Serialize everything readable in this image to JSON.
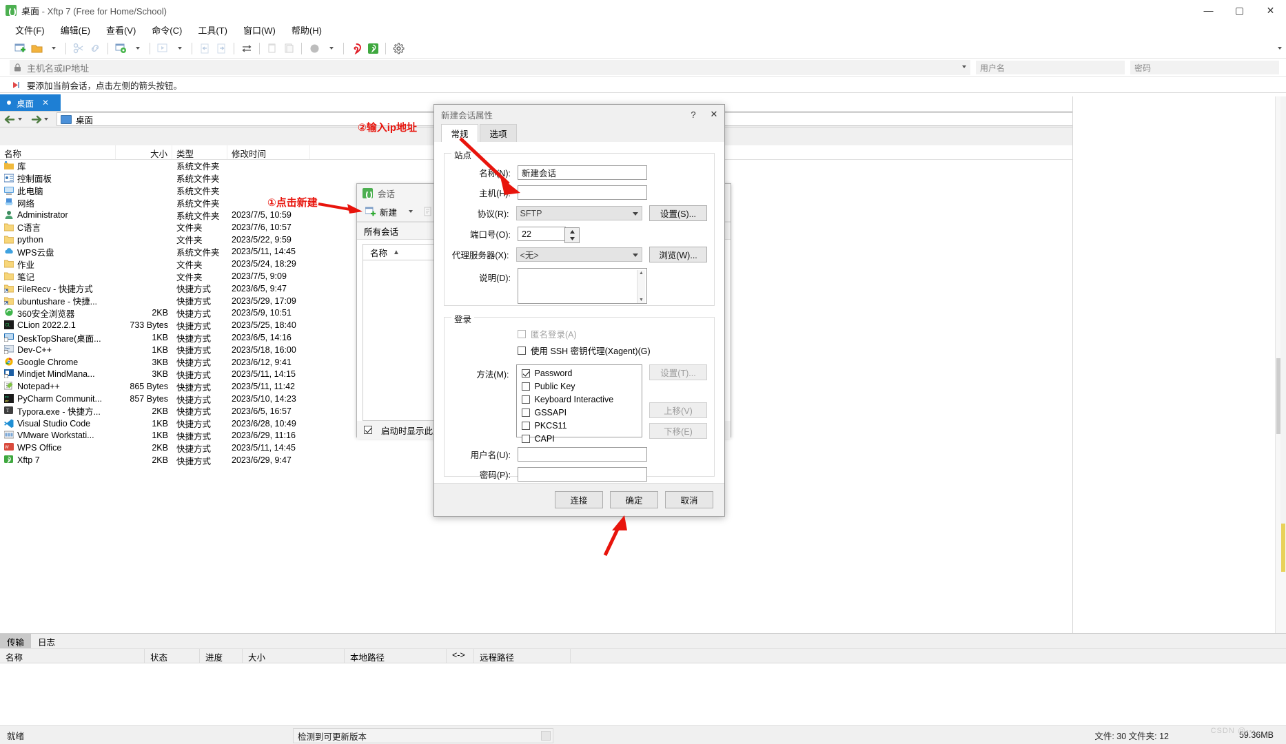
{
  "window": {
    "title_main": "桌面",
    "title_rest": " - Xftp 7 (Free for Home/School)",
    "minimize": "—",
    "maximize": "▢",
    "close": "✕"
  },
  "menubar": {
    "items": [
      "文件(F)",
      "编辑(E)",
      "查看(V)",
      "命令(C)",
      "工具(T)",
      "窗口(W)",
      "帮助(H)"
    ]
  },
  "addressbar": {
    "host_placeholder": "主机名或IP地址",
    "username_placeholder": "用户名",
    "password_placeholder": "密码"
  },
  "hintbar": {
    "text": "要添加当前会话，点击左侧的箭头按钮。"
  },
  "tabs": {
    "active_label": "桌面",
    "close": "✕",
    "nav_left": "◄",
    "nav_right": "►"
  },
  "pathbar": {
    "back": "←",
    "forward": "→",
    "path": "桌面",
    "star": "★",
    "refresh": "⟳"
  },
  "filelist": {
    "columns": [
      "名称",
      "大小",
      "类型",
      "修改时间"
    ],
    "rows": [
      {
        "name": "库",
        "size": "",
        "type": "系统文件夹",
        "time": "",
        "icon": "library-folder-icon"
      },
      {
        "name": "控制面板",
        "size": "",
        "type": "系统文件夹",
        "time": "",
        "icon": "control-panel-icon"
      },
      {
        "name": "此电脑",
        "size": "",
        "type": "系统文件夹",
        "time": "",
        "icon": "this-pc-icon"
      },
      {
        "name": "网络",
        "size": "",
        "type": "系统文件夹",
        "time": "",
        "icon": "network-icon"
      },
      {
        "name": "Administrator",
        "size": "",
        "type": "系统文件夹",
        "time": "2023/7/5, 10:59",
        "icon": "user-icon"
      },
      {
        "name": "C语言",
        "size": "",
        "type": "文件夹",
        "time": "2023/7/6, 10:57",
        "icon": "folder-icon"
      },
      {
        "name": "python",
        "size": "",
        "type": "文件夹",
        "time": "2023/5/22, 9:59",
        "icon": "folder-icon"
      },
      {
        "name": "WPS云盘",
        "size": "",
        "type": "系统文件夹",
        "time": "2023/5/11, 14:45",
        "icon": "cloud-icon"
      },
      {
        "name": "作业",
        "size": "",
        "type": "文件夹",
        "time": "2023/5/24, 18:29",
        "icon": "folder-icon"
      },
      {
        "name": "笔记",
        "size": "",
        "type": "文件夹",
        "time": "2023/7/5, 9:09",
        "icon": "folder-icon"
      },
      {
        "name": "FileRecv - 快捷方式",
        "size": "",
        "type": "快捷方式",
        "time": "2023/6/5, 9:47",
        "icon": "folder-shortcut-icon"
      },
      {
        "name": "ubuntushare - 快捷...",
        "size": "",
        "type": "快捷方式",
        "time": "2023/5/29, 17:09",
        "icon": "folder-shortcut-icon"
      },
      {
        "name": "360安全浏览器",
        "size": "2KB",
        "type": "快捷方式",
        "time": "2023/5/9, 10:51",
        "icon": "browser-360-icon"
      },
      {
        "name": "CLion 2022.2.1",
        "size": "733 Bytes",
        "type": "快捷方式",
        "time": "2023/5/25, 18:40",
        "icon": "clion-icon"
      },
      {
        "name": "DeskTopShare(桌面...",
        "size": "1KB",
        "type": "快捷方式",
        "time": "2023/6/5, 14:16",
        "icon": "desktopshare-icon"
      },
      {
        "name": "Dev-C++",
        "size": "1KB",
        "type": "快捷方式",
        "time": "2023/5/18, 16:00",
        "icon": "devcpp-icon"
      },
      {
        "name": "Google Chrome",
        "size": "3KB",
        "type": "快捷方式",
        "time": "2023/6/12, 9:41",
        "icon": "chrome-icon"
      },
      {
        "name": "Mindjet MindMana...",
        "size": "3KB",
        "type": "快捷方式",
        "time": "2023/5/11, 14:15",
        "icon": "mindjet-icon"
      },
      {
        "name": "Notepad++",
        "size": "865 Bytes",
        "type": "快捷方式",
        "time": "2023/5/11, 11:42",
        "icon": "notepadpp-icon"
      },
      {
        "name": "PyCharm Communit...",
        "size": "857 Bytes",
        "type": "快捷方式",
        "time": "2023/5/10, 14:23",
        "icon": "pycharm-icon"
      },
      {
        "name": "Typora.exe - 快捷方...",
        "size": "2KB",
        "type": "快捷方式",
        "time": "2023/6/5, 16:57",
        "icon": "typora-icon"
      },
      {
        "name": "Visual Studio Code",
        "size": "1KB",
        "type": "快捷方式",
        "time": "2023/6/28, 10:49",
        "icon": "vscode-icon"
      },
      {
        "name": "VMware Workstati...",
        "size": "1KB",
        "type": "快捷方式",
        "time": "2023/6/29, 11:16",
        "icon": "vmware-icon"
      },
      {
        "name": "WPS Office",
        "size": "2KB",
        "type": "快捷方式",
        "time": "2023/5/11, 14:45",
        "icon": "wps-icon"
      },
      {
        "name": "Xftp 7",
        "size": "2KB",
        "type": "快捷方式",
        "time": "2023/6/29, 9:47",
        "icon": "xftp-icon"
      }
    ]
  },
  "transfer_panel": {
    "tabs": [
      "传输",
      "日志"
    ],
    "active_tab": "传输",
    "columns": [
      "名称",
      "状态",
      "进度",
      "大小",
      "本地路径",
      "<->",
      "远程路径"
    ]
  },
  "statusbar": {
    "ready": "就绪",
    "update_text": "检测到可更新版本",
    "files": "文件: 30  文件夹: 12",
    "size": "59.36MB",
    "watermark": "CSDN @🞄🞄🞄"
  },
  "sessions_window": {
    "title": "会话",
    "close": "✕",
    "new_button": "新建",
    "all_sessions": "所有会话",
    "list_column": "名称",
    "sort_arrow": "▲",
    "startup_checkbox": "启动时显示此对话框(",
    "startup_checked": true
  },
  "dialog": {
    "title": "新建会话属性",
    "help": "?",
    "close": "✕",
    "tabs": [
      "常规",
      "选项"
    ],
    "active_tab": "常规",
    "site_group": "站点",
    "fields": {
      "name_label": "名称(N):",
      "name_value": "新建会话",
      "host_label": "主机(H):",
      "host_value": "",
      "protocol_label": "协议(R):",
      "protocol_value": "SFTP",
      "protocol_button": "设置(S)...",
      "port_label": "端口号(O):",
      "port_value": "22",
      "proxy_label": "代理服务器(X):",
      "proxy_value": "<无>",
      "proxy_button": "浏览(W)...",
      "desc_label": "说明(D):",
      "desc_value": ""
    },
    "login_group": "登录",
    "anonymous_label": "匿名登录(A)",
    "anonymous_checked": false,
    "xagent_label": "使用 SSH 密钥代理(Xagent)(G)",
    "xagent_checked": false,
    "method_label": "方法(M):",
    "methods": [
      {
        "label": "Password",
        "checked": true
      },
      {
        "label": "Public Key",
        "checked": false
      },
      {
        "label": "Keyboard Interactive",
        "checked": false
      },
      {
        "label": "GSSAPI",
        "checked": false
      },
      {
        "label": "PKCS11",
        "checked": false
      },
      {
        "label": "CAPI",
        "checked": false
      }
    ],
    "method_buttons": [
      "设置(T)...",
      "上移(V)",
      "下移(E)"
    ],
    "user_label": "用户名(U):",
    "user_value": "",
    "password_label": "密码(P):",
    "password_value": "",
    "footer_buttons": [
      "连接",
      "确定",
      "取消"
    ]
  },
  "annotations": {
    "step1": "①点击新建",
    "step2": "②输入ip地址"
  },
  "colors": {
    "accent": "#1e7fd4",
    "annotation": "#e8140c",
    "brand_green": "#4caf50"
  }
}
